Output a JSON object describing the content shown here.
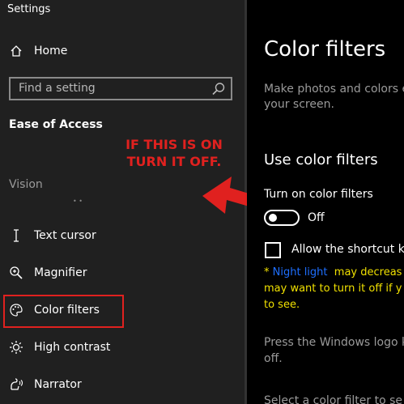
{
  "window": {
    "title": "Settings"
  },
  "sidebar": {
    "home_label": "Home",
    "search_placeholder": "Find a setting",
    "section_title": "Ease of Access",
    "group_label": "Vision",
    "items": [
      {
        "label": "Text cursor",
        "icon": "text-cursor-icon"
      },
      {
        "label": "Magnifier",
        "icon": "magnifier-icon"
      },
      {
        "label": "Color filters",
        "icon": "palette-icon"
      },
      {
        "label": "High contrast",
        "icon": "sun-icon"
      },
      {
        "label": "Narrator",
        "icon": "narrator-icon"
      }
    ]
  },
  "annotation": {
    "line1": "IF THIS IS ON",
    "line2": "TURN IT OFF.",
    "color": "#e0211f"
  },
  "main": {
    "title": "Color filters",
    "description_line1": "Make photos and colors e",
    "description_line2": "your screen.",
    "section_heading": "Use color filters",
    "toggle_label": "Turn on color filters",
    "toggle_state": "Off",
    "toggle_on": false,
    "shortcut_label": "Allow the shortcut key",
    "shortcut_checked": false,
    "note_prefix": "* ",
    "note_link": "Night light",
    "note_line1_rest": "  may decreas",
    "note_line2": "may want to turn it off if y",
    "note_line3": "to see.",
    "press_line1": "Press the Windows logo k",
    "press_line2": "off.",
    "select_text": "Select a color filter to se"
  }
}
